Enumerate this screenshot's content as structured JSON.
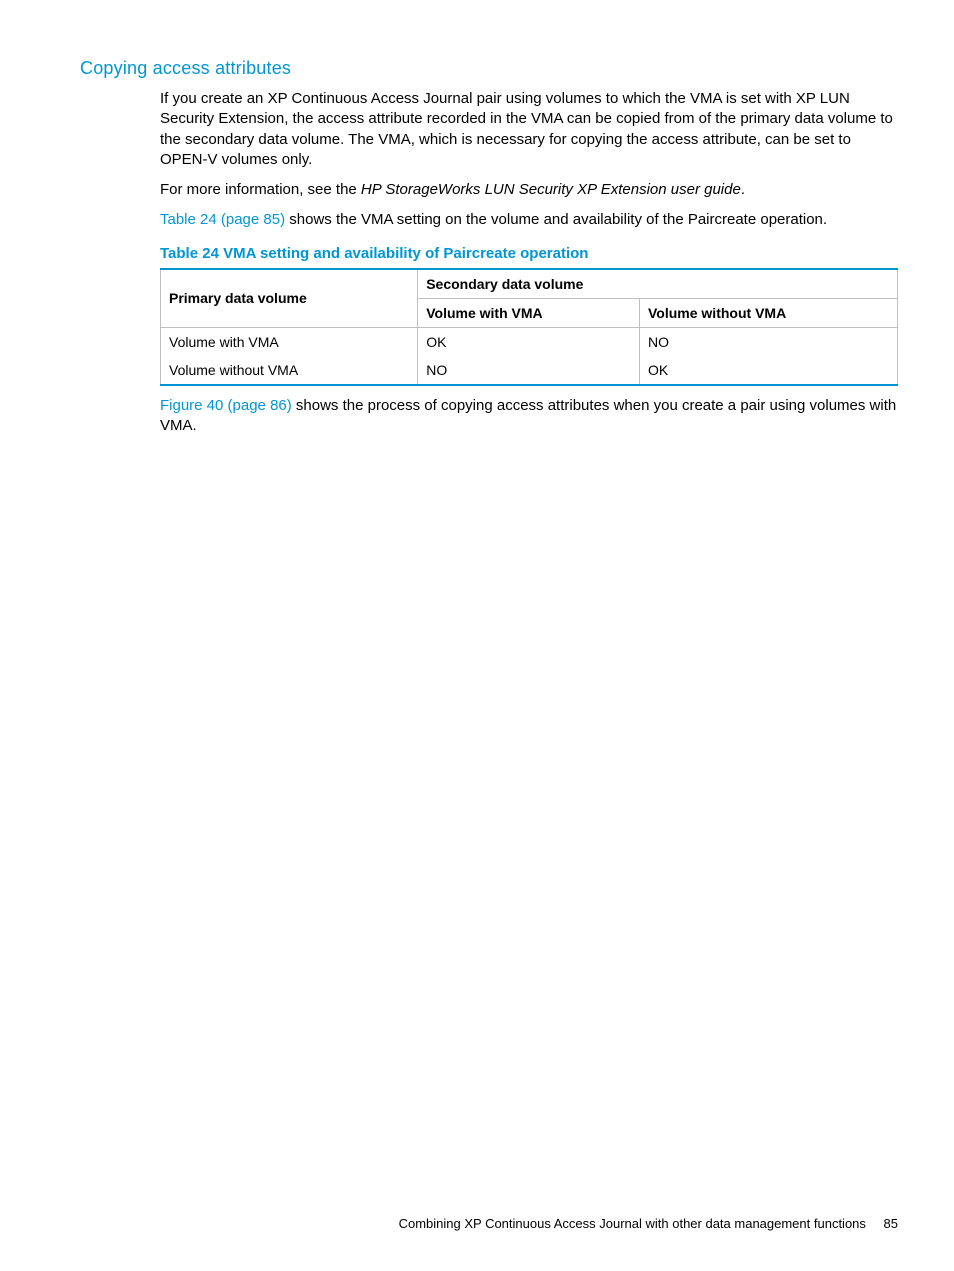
{
  "heading": "Copying access attributes",
  "para1": "If you create an XP Continuous Access Journal pair using volumes to which the VMA is set with XP LUN Security Extension, the access attribute recorded in the VMA can be copied from of the primary data volume to the secondary data volume. The VMA, which is necessary for copying the access attribute, can be set to OPEN-V volumes only.",
  "para2_pre": "For more information, see the ",
  "para2_italic": "HP StorageWorks LUN Security XP Extension user guide",
  "para2_post": ".",
  "para3_link": "Table 24 (page 85)",
  "para3_rest": " shows the VMA setting on the volume and availability of the Paircreate operation.",
  "table": {
    "caption": "Table 24 VMA setting and availability of Paircreate operation",
    "head_primary": "Primary data volume",
    "head_secondary": "Secondary data volume",
    "sub_with": "Volume with VMA",
    "sub_without": "Volume without VMA",
    "rows": [
      {
        "p": "Volume with VMA",
        "c1": "OK",
        "c2": "NO"
      },
      {
        "p": "Volume without VMA",
        "c1": "NO",
        "c2": "OK"
      }
    ]
  },
  "para4_link": "Figure 40 (page 86)",
  "para4_rest": " shows the process of copying access attributes when you create a pair using volumes with VMA.",
  "footer_text": "Combining XP Continuous Access Journal with other data management functions",
  "footer_page": "85"
}
